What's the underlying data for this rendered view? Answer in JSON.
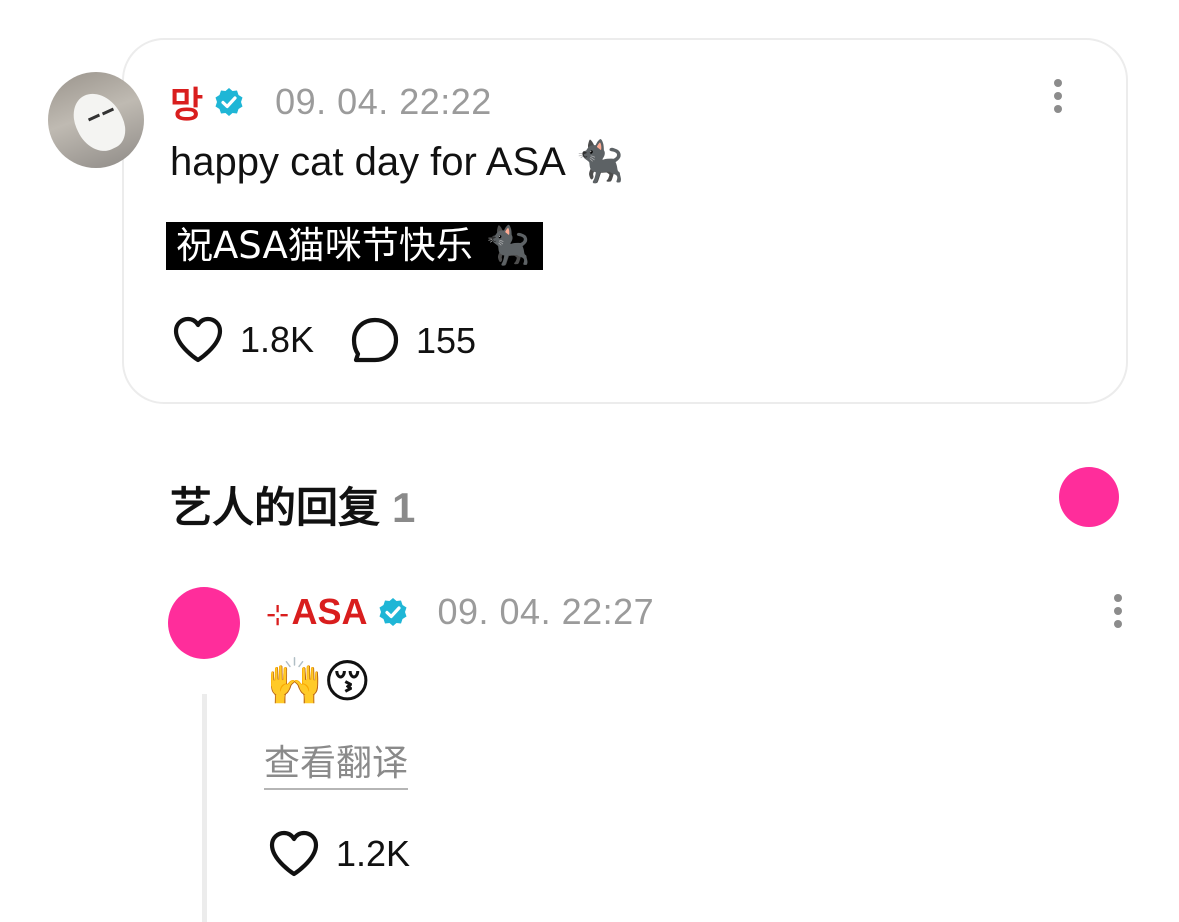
{
  "post": {
    "author": "망",
    "timestamp": "09. 04. 22:22",
    "text": "happy cat day for ASA",
    "text_emoji": "🐈‍⬛",
    "caption": "祝ASA猫咪节快乐",
    "caption_emoji": "🐈‍⬛",
    "likes": "1.8K",
    "comments": "155"
  },
  "section": {
    "title": "艺人的回复",
    "count": "1"
  },
  "reply": {
    "author_prefix": "⊹",
    "author": "ASA",
    "timestamp": "09. 04. 22:27",
    "emoji": "🙌😚",
    "translate_label": "查看翻译",
    "likes": "1.2K"
  },
  "icons": {
    "verified": "verified-badge-icon",
    "more": "more-vertical-icon",
    "like": "heart-icon",
    "comment": "comment-bubble-icon"
  },
  "colors": {
    "author_name": "#d91e1e",
    "verified": "#1fb6d6",
    "artist_pink": "#ff2d9b",
    "meta_gray": "#9b9b9b"
  }
}
